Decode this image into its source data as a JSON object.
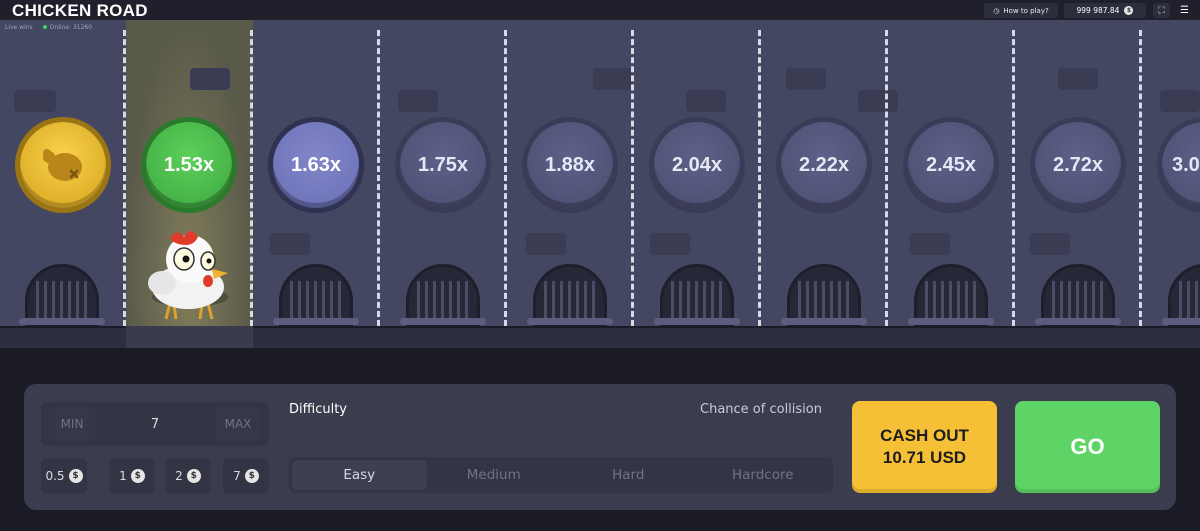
{
  "header": {
    "logo": "CHICKEN ROAD",
    "how_to_play": "How to play?",
    "balance": "999 987.84",
    "currency_symbol": "$"
  },
  "status": {
    "live_wins": "Live wins",
    "online": "Online: 31260"
  },
  "road": {
    "lanes": [
      {
        "kind": "start",
        "label": ""
      },
      {
        "kind": "won",
        "label": "1.53x"
      },
      {
        "kind": "next",
        "label": "1.63x"
      },
      {
        "kind": "locked",
        "label": "1.75x"
      },
      {
        "kind": "locked",
        "label": "1.88x"
      },
      {
        "kind": "locked",
        "label": "2.04x"
      },
      {
        "kind": "locked",
        "label": "2.22x"
      },
      {
        "kind": "locked",
        "label": "2.45x"
      },
      {
        "kind": "locked",
        "label": "2.72x"
      },
      {
        "kind": "locked",
        "label": "3.0"
      }
    ],
    "colors": {
      "won": "#3da640",
      "next": "#6a6eb3",
      "locked": "#4a4d6e",
      "gold": "#d6a21c"
    }
  },
  "controls": {
    "bet": {
      "min_label": "MIN",
      "value": "7",
      "max_label": "MAX"
    },
    "quick_bets": [
      {
        "value": "0.5"
      },
      {
        "value": "1"
      },
      {
        "value": "2"
      },
      {
        "value": "7"
      }
    ],
    "difficulty_label": "Difficulty",
    "collision_label": "Chance of collision",
    "difficulty_options": [
      "Easy",
      "Medium",
      "Hard",
      "Hardcore"
    ],
    "difficulty_selected": "Easy",
    "cash_out": {
      "line1": "CASH OUT",
      "line2": "10.71 USD"
    },
    "go_label": "GO",
    "colors": {
      "cash_out": "#f5c035",
      "go": "#5ed466"
    }
  }
}
